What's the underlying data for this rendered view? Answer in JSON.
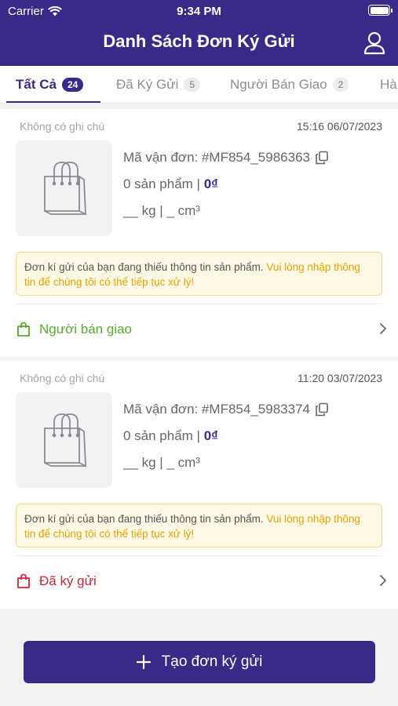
{
  "status_bar": {
    "carrier": "Carrier",
    "time": "9:34 PM"
  },
  "header": {
    "title": "Danh Sách Đơn Ký Gửi"
  },
  "tabs": [
    {
      "label": "Tất Cả",
      "count": "24"
    },
    {
      "label": "Đã Ký Gửi",
      "count": "5"
    },
    {
      "label": "Người Bán Giao",
      "count": "2"
    },
    {
      "label": "Hà"
    }
  ],
  "orders": [
    {
      "note": "Không có ghi chú",
      "time": "15:16 06/07/2023",
      "code": "Mã vận đơn: #MF854_5986363",
      "qty": "0 sản phẩm | ",
      "price": "0₫",
      "dims": "__ kg | _ cm³",
      "warning_text": "Đơn kí gửi của bạn đang thiếu thông tin sản phẩm. ",
      "warning_highlight": "Vui lòng nhập thông tin để chúng tôi có thể tiếp tục xử lý!",
      "status": "Người bán giao",
      "status_color": "#5aa832"
    },
    {
      "note": "Không có ghi chú",
      "time": "11:20 03/07/2023",
      "code": "Mã vận đơn: #MF854_5983374",
      "qty": "0 sản phẩm | ",
      "price": "0₫",
      "dims": "__ kg | _ cm³",
      "warning_text": "Đơn kí gửi của bạn đang thiếu thông tin sản phẩm. ",
      "warning_highlight": "Vui lòng nhập thông tin để chúng tôi có thể tiếp tục xử lý!",
      "status": "Đã ký gửi",
      "status_color": "#c8283a"
    }
  ],
  "footer": {
    "create_label": "Tạo đơn ký gửi"
  },
  "colors": {
    "brand": "#3a2a88",
    "warning_accent": "#e8a200"
  }
}
